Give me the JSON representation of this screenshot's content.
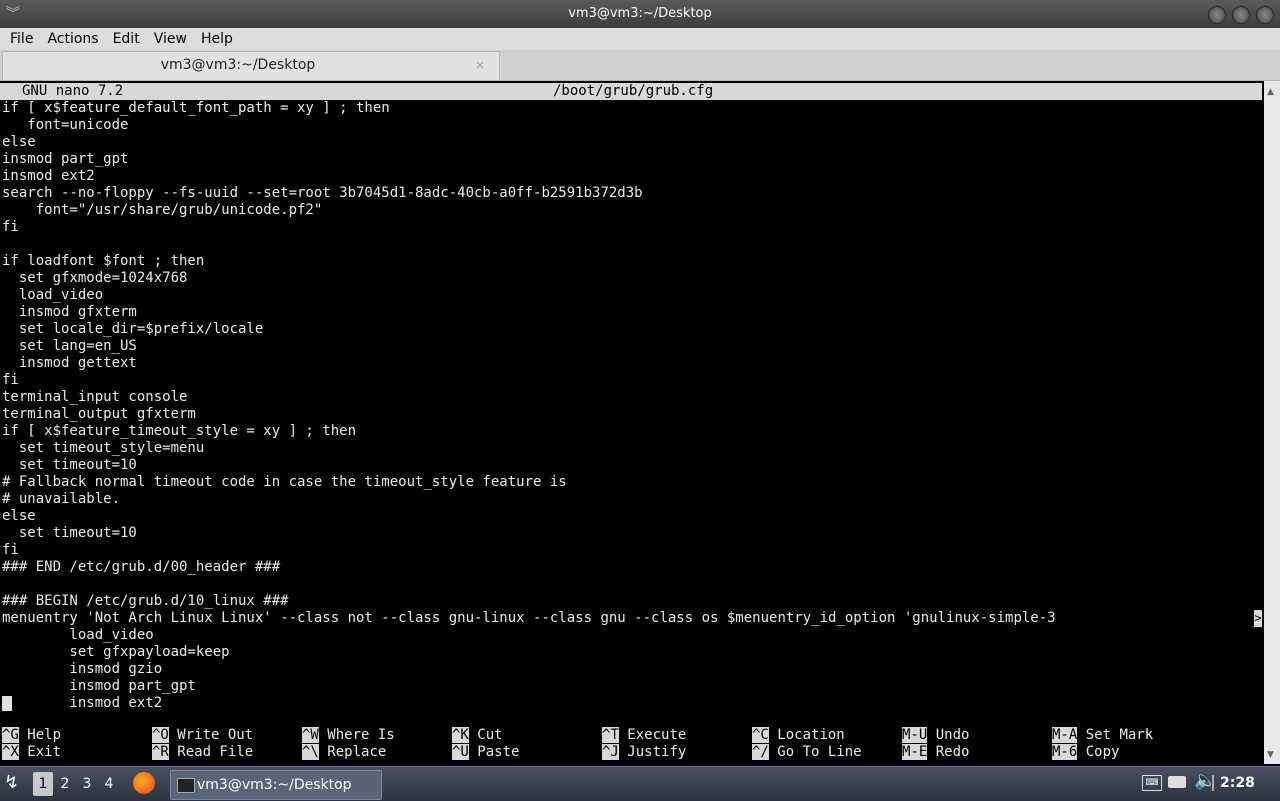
{
  "window": {
    "title": "vm3@vm3:~/Desktop"
  },
  "menubar": {
    "items": [
      "File",
      "Actions",
      "Edit",
      "View",
      "Help"
    ]
  },
  "tab": {
    "label": "vm3@vm3:~/Desktop",
    "close": "×"
  },
  "nano": {
    "version": "GNU nano 7.2",
    "filename": "/boot/grub/grub.cfg",
    "lines": [
      "if [ x$feature_default_font_path = xy ] ; then",
      "   font=unicode",
      "else",
      "insmod part_gpt",
      "insmod ext2",
      "search --no-floppy --fs-uuid --set=root 3b7045d1-8adc-40cb-a0ff-b2591b372d3b",
      "    font=\"/usr/share/grub/unicode.pf2\"",
      "fi",
      "",
      "if loadfont $font ; then",
      "  set gfxmode=1024x768",
      "  load_video",
      "  insmod gfxterm",
      "  set locale_dir=$prefix/locale",
      "  set lang=en_US",
      "  insmod gettext",
      "fi",
      "terminal_input console",
      "terminal_output gfxterm",
      "if [ x$feature_timeout_style = xy ] ; then",
      "  set timeout_style=menu",
      "  set timeout=10",
      "# Fallback normal timeout code in case the timeout_style feature is",
      "# unavailable.",
      "else",
      "  set timeout=10",
      "fi",
      "### END /etc/grub.d/00_header ###",
      "",
      "### BEGIN /etc/grub.d/10_linux ###",
      "menuentry 'Not Arch Linux Linux' --class not --class gnu-linux --class gnu --class os $menuentry_id_option 'gnulinux-simple-3",
      "        load_video",
      "        set gfxpayload=keep",
      "        insmod gzio",
      "        insmod part_gpt",
      "        insmod ext2"
    ],
    "overflow_marker": ">",
    "shortcuts": [
      {
        "key": "^G",
        "label": "Help"
      },
      {
        "key": "^X",
        "label": "Exit"
      },
      {
        "key": "^O",
        "label": "Write Out"
      },
      {
        "key": "^R",
        "label": "Read File"
      },
      {
        "key": "^W",
        "label": "Where Is"
      },
      {
        "key": "^\\",
        "label": "Replace"
      },
      {
        "key": "^K",
        "label": "Cut"
      },
      {
        "key": "^U",
        "label": "Paste"
      },
      {
        "key": "^T",
        "label": "Execute"
      },
      {
        "key": "^J",
        "label": "Justify"
      },
      {
        "key": "^C",
        "label": "Location"
      },
      {
        "key": "^/",
        "label": "Go To Line"
      },
      {
        "key": "M-U",
        "label": "Undo"
      },
      {
        "key": "M-E",
        "label": "Redo"
      },
      {
        "key": "M-A",
        "label": "Set Mark"
      },
      {
        "key": "M-6",
        "label": "Copy"
      }
    ]
  },
  "taskbar": {
    "desktops": [
      "1",
      "2",
      "3",
      "4"
    ],
    "active_desktop": "1",
    "task_label": "vm3@vm3:~/Desktop",
    "clock": "2:28"
  }
}
